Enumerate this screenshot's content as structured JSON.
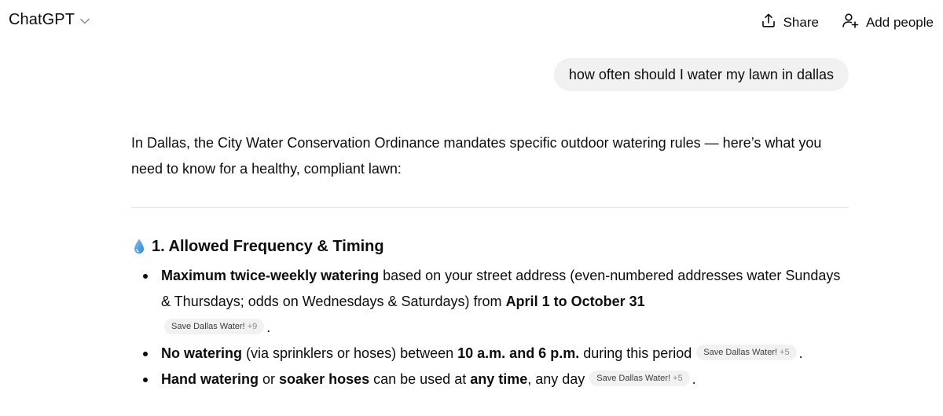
{
  "header": {
    "model_name": "ChatGPT",
    "share_label": "Share",
    "add_people_label": "Add people"
  },
  "user_message": "how often should I water my lawn in dallas",
  "answer": {
    "intro": "In Dallas, the City Water Conservation Ordinance mandates specific outdoor watering rules — here’s what you need to know for a healthy, compliant lawn:",
    "section_title": "1. Allowed Frequency & Timing",
    "section_icon": "droplet-icon",
    "bullets": [
      {
        "bold1": "Maximum twice-weekly watering",
        "text1": " based on your street address (even-numbered addresses water Sundays & Thursdays; odds on Wednesdays & Saturdays) from ",
        "bold2": "April 1 to October 31",
        "citation": {
          "source": "Save Dallas Water!",
          "more": "+9"
        },
        "end": "."
      },
      {
        "bold1": "No watering",
        "text1": " (via sprinklers or hoses) between ",
        "bold2": "10 a.m. and 6 p.m.",
        "text2": " during this period",
        "citation": {
          "source": "Save Dallas Water!",
          "more": "+5"
        },
        "end": "."
      },
      {
        "bold1": "Hand watering",
        "text1": " or ",
        "bold2": "soaker hoses",
        "text2": " can be used at ",
        "bold3": "any time",
        "text3": ", any day",
        "citation": {
          "source": "Save Dallas Water!",
          "more": "+5"
        },
        "end": "."
      }
    ]
  },
  "colors": {
    "text": "#0d0d0d",
    "bubble_bg": "#f1f1f1",
    "divider": "#e6e6e6",
    "droplet": "#4a9ee0"
  }
}
